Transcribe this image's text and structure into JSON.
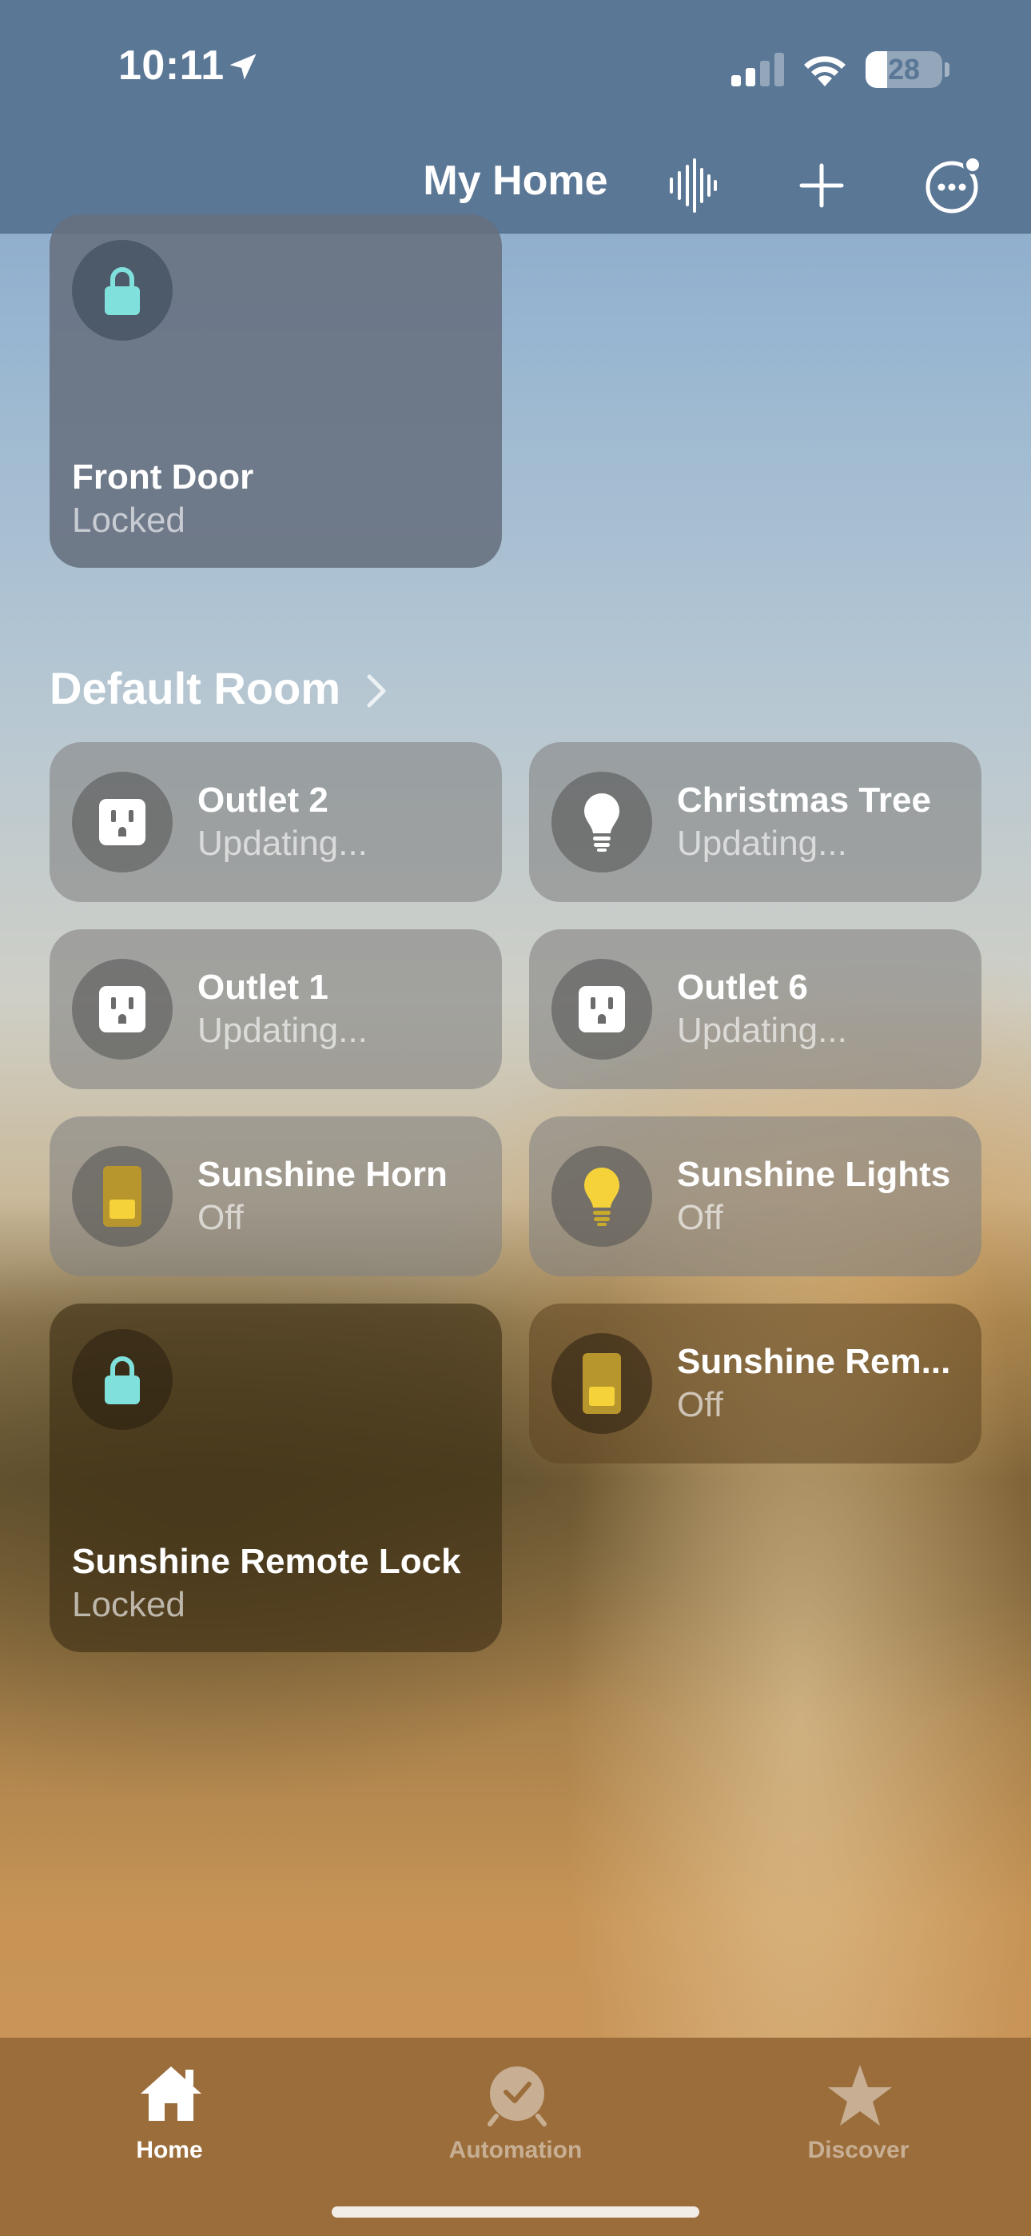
{
  "status_bar": {
    "time": "10:11",
    "battery_level": "28",
    "battery_fraction": 0.28,
    "icons": [
      "location-arrow-icon",
      "cellular-signal-icon",
      "wifi-icon",
      "battery-icon"
    ]
  },
  "nav": {
    "title": "My Home",
    "buttons": [
      "voice-waveform-icon",
      "plus-icon",
      "more-ellipsis-icon"
    ]
  },
  "tiles": {
    "front_door": {
      "name": "Front Door",
      "status": "Locked",
      "icon": "lock-icon"
    },
    "section_title": "Default Room",
    "outlet_2": {
      "name": "Outlet 2",
      "status": "Updating...",
      "icon": "outlet-icon"
    },
    "christmas_tree": {
      "name": "Christmas Tree",
      "status": "Updating...",
      "icon": "lightbulb-icon"
    },
    "outlet_1": {
      "name": "Outlet 1",
      "status": "Updating...",
      "icon": "outlet-icon"
    },
    "outlet_6": {
      "name": "Outlet 6",
      "status": "Updating...",
      "icon": "outlet-icon"
    },
    "sunshine_horn": {
      "name": "Sunshine Horn",
      "status": "Off",
      "icon": "switch-icon"
    },
    "sunshine_lights": {
      "name": "Sunshine Lights",
      "status": "Off",
      "icon": "lightbulb-icon"
    },
    "sunshine_remote_lock": {
      "name": "Sunshine Remote Lock",
      "status": "Locked",
      "icon": "lock-icon"
    },
    "sunshine_rem": {
      "name": "Sunshine Rem...",
      "status": "Off",
      "icon": "switch-icon"
    }
  },
  "tab_bar": {
    "tabs": [
      {
        "label": "Home",
        "icon": "home-icon",
        "selected": true
      },
      {
        "label": "Automation",
        "icon": "clock-check-icon",
        "selected": false
      },
      {
        "label": "Discover",
        "icon": "star-icon",
        "selected": false
      }
    ]
  },
  "colors": {
    "lock_accent": "#7fe0dc",
    "on_yellow": "#f6d23a",
    "nav_bg": "#5a7796",
    "tab_bg": "#9b6d3b"
  }
}
